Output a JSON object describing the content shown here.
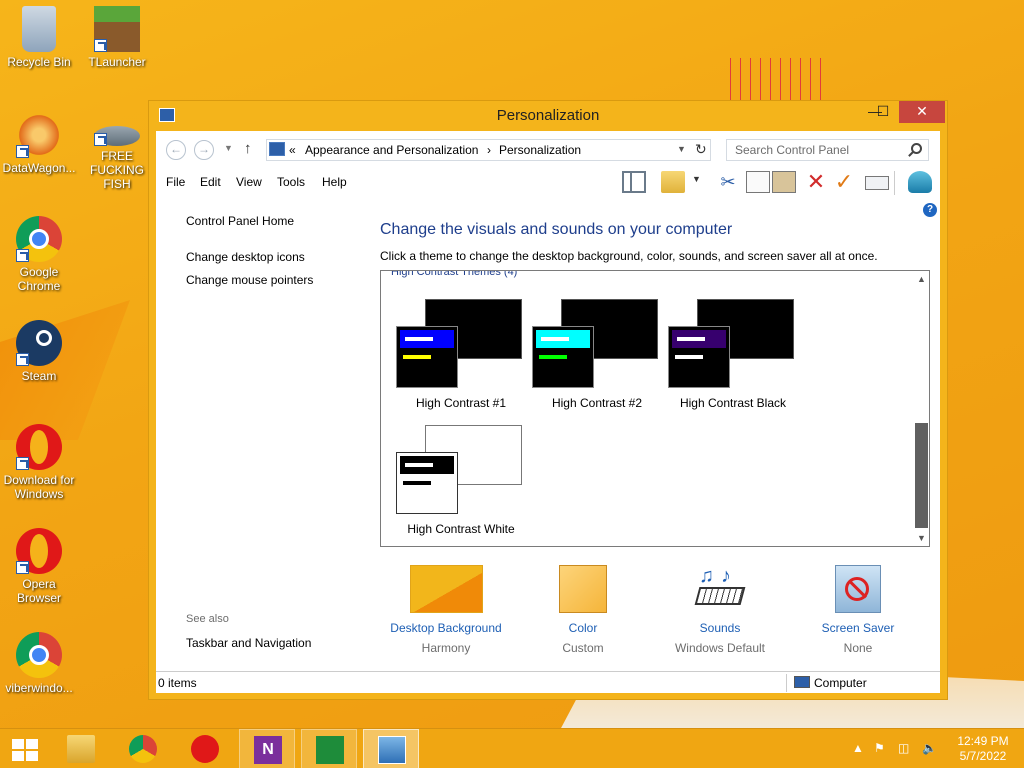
{
  "desktop": {
    "icons": [
      {
        "label": "Recycle Bin"
      },
      {
        "label": "TLauncher"
      },
      {
        "label": "DataWagon..."
      },
      {
        "label": "FREE FUCKING FISH"
      },
      {
        "label": "Google Chrome"
      },
      {
        "label": "Steam"
      },
      {
        "label": "Download for Windows"
      },
      {
        "label": "Opera Browser"
      },
      {
        "label": "viberwindo..."
      }
    ]
  },
  "window": {
    "title": "Personalization",
    "controls": {
      "minimize": "—",
      "maximize": "☐",
      "close": "✕"
    },
    "address": {
      "prefix": "«",
      "crumbs": [
        "Appearance and Personalization",
        "Personalization"
      ],
      "separator": "›"
    },
    "search": {
      "placeholder": "Search Control Panel"
    },
    "menu": [
      "File",
      "Edit",
      "View",
      "Tools",
      "Help"
    ],
    "left_pane": {
      "links": [
        "Control Panel Home",
        "Change desktop icons",
        "Change mouse pointers"
      ],
      "see_also_label": "See also",
      "see_also_links": [
        "Taskbar and Navigation"
      ]
    },
    "main": {
      "title": "Change the visuals and sounds on your computer",
      "subtitle": "Click a theme to change the desktop background, color, sounds, and screen saver all at once.",
      "group_header": "High Contrast Themes (4)",
      "themes": [
        {
          "name": "High Contrast #1",
          "accent": "#0000ff",
          "secondary": "#ffff00"
        },
        {
          "name": "High Contrast #2",
          "accent": "#00ffff",
          "secondary": "#00ff00"
        },
        {
          "name": "High Contrast Black",
          "accent": "#37006e",
          "secondary": "#ffffff"
        },
        {
          "name": "High Contrast White",
          "accent": "#000000",
          "secondary": "#000000"
        }
      ]
    },
    "bottom_items": [
      {
        "label": "Desktop Background",
        "value": "Harmony"
      },
      {
        "label": "Color",
        "value": "Custom"
      },
      {
        "label": "Sounds",
        "value": "Windows Default"
      },
      {
        "label": "Screen Saver",
        "value": "None"
      }
    ],
    "status": {
      "left": "0 items",
      "right": "Computer"
    }
  },
  "taskbar": {
    "clock_time": "12:49 PM",
    "clock_date": "5/7/2022",
    "tray_chevron": "▲"
  },
  "colors": {
    "link_blue": "#1e5fb4",
    "heading_blue": "#1e3e8c",
    "close_red": "#c7463e",
    "window_frame": "#f4b41b"
  }
}
